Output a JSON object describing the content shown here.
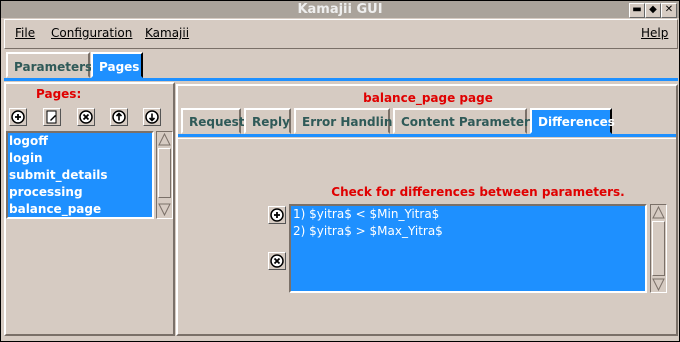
{
  "window": {
    "title": "Kamajii GUI"
  },
  "menu": {
    "file": "File",
    "configuration": "Configuration",
    "kamajii": "Kamajii",
    "help": "Help"
  },
  "main_tabs": [
    {
      "label": "Parameters"
    },
    {
      "label": "Pages"
    }
  ],
  "pages": {
    "label": "Pages:",
    "items": [
      "logoff",
      "login",
      "submit_details",
      "processing",
      "balance_page"
    ]
  },
  "page_panel": {
    "title": "balance_page page",
    "tabs": [
      "Request",
      "Reply",
      "Error Handling",
      "Content Parameters",
      "Differences"
    ],
    "active_tab": "Differences"
  },
  "differences": {
    "label": "Check for differences between parameters.",
    "items": [
      "1) $yitra$ < $Min_Yitra$",
      "2) $yitra$ > $Max_Yitra$"
    ]
  },
  "colors": {
    "selection": "#1e90ff",
    "background": "#d6cbc2",
    "label_red": "#e00000"
  }
}
